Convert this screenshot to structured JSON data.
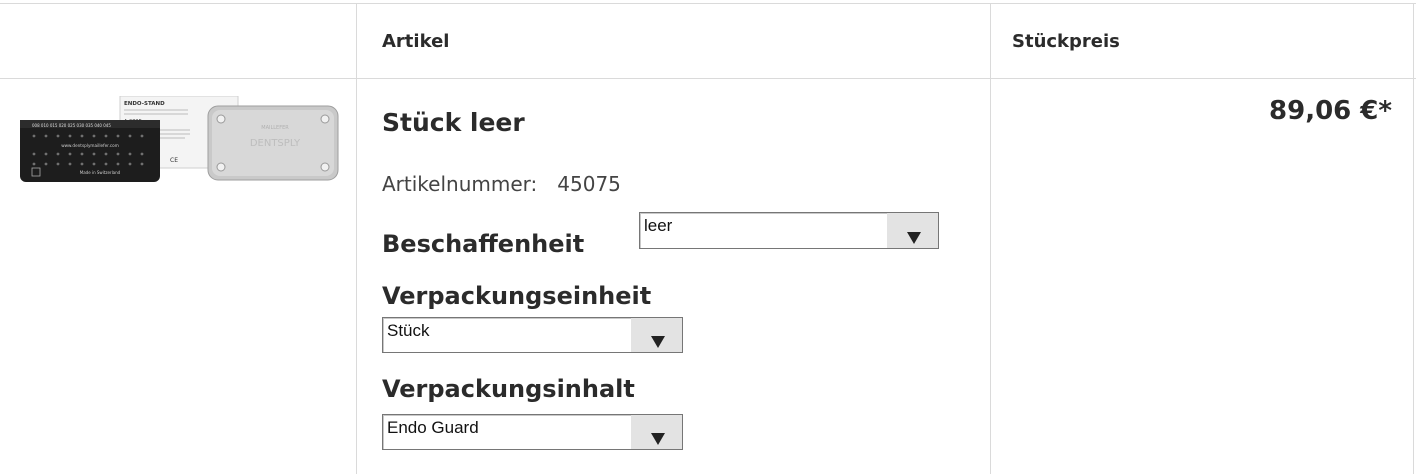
{
  "header": {
    "col_article": "Artikel",
    "col_price": "Stückpreis"
  },
  "product": {
    "title": "Stück leer",
    "article_number_label": "Artikelnummer:",
    "article_number": "45075",
    "price": "89,06 €*",
    "image_alt": "Endo-Stand product image",
    "image_text": {
      "box_label": "ENDO-STAND",
      "box_code": "A 283P",
      "box_lid_brand": "DENTSPLY",
      "box_lid_text": "MAILLEFER",
      "stand_url": "www.dentsplymaillefer.com",
      "stand_origin": "Made in Switzerland",
      "stand_numbers": "008 010 015 020 025 030 035 040 045",
      "ce_mark": "CE"
    }
  },
  "options": [
    {
      "label": "Beschaffenheit",
      "selected": "leer"
    },
    {
      "label": "Verpackungseinheit",
      "selected": "Stück"
    },
    {
      "label": "Verpackungsinhalt",
      "selected": "Endo Guard"
    }
  ]
}
